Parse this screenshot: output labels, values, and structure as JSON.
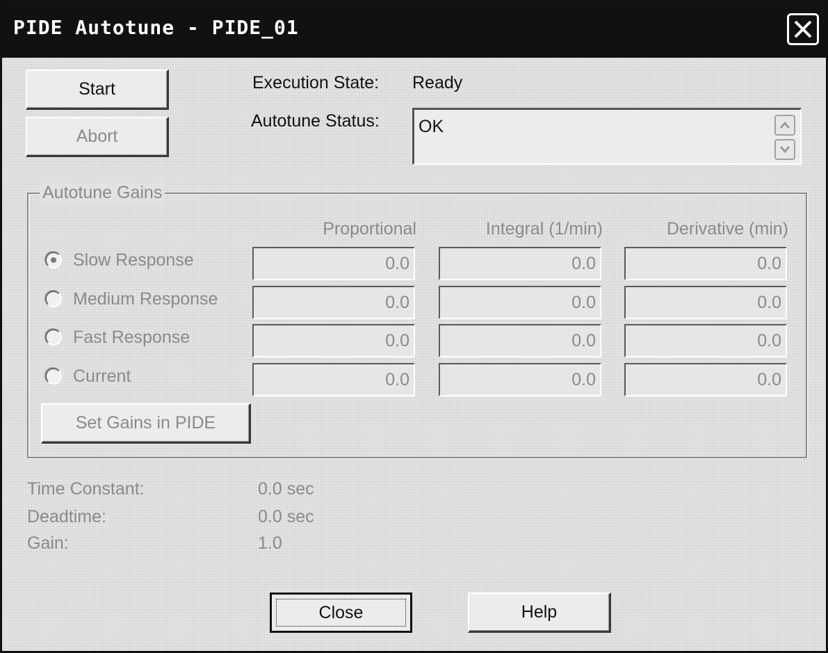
{
  "window": {
    "title": "PIDE Autotune - PIDE_01"
  },
  "buttons": {
    "start": "Start",
    "abort": "Abort",
    "set_gains": "Set Gains in PIDE",
    "close": "Close",
    "help": "Help"
  },
  "execution": {
    "label": "Execution State:",
    "value": "Ready"
  },
  "autotune_status": {
    "label": "Autotune Status:",
    "value": "OK"
  },
  "gains": {
    "group_label": "Autotune Gains",
    "columns": [
      "Proportional",
      "Integral (1/min)",
      "Derivative (min)"
    ],
    "rows": [
      {
        "label": "Slow Response",
        "selected": true,
        "values": [
          "0.0",
          "0.0",
          "0.0"
        ]
      },
      {
        "label": "Medium Response",
        "selected": false,
        "values": [
          "0.0",
          "0.0",
          "0.0"
        ]
      },
      {
        "label": "Fast Response",
        "selected": false,
        "values": [
          "0.0",
          "0.0",
          "0.0"
        ]
      },
      {
        "label": "Current",
        "selected": false,
        "values": [
          "0.0",
          "0.0",
          "0.0"
        ]
      }
    ]
  },
  "model": [
    {
      "label": "Time Constant:",
      "value": "0.0 sec"
    },
    {
      "label": "Deadtime:",
      "value": "0.0 sec"
    },
    {
      "label": "Gain:",
      "value": "1.0"
    }
  ],
  "colors": {
    "titlebar": "#111111",
    "dialog_bg": "#e2e2e2",
    "disabled_text": "#8a8a8a"
  },
  "icons": {
    "close": "close-icon",
    "scroll_up": "chevron-up-icon",
    "scroll_down": "chevron-down-icon"
  }
}
